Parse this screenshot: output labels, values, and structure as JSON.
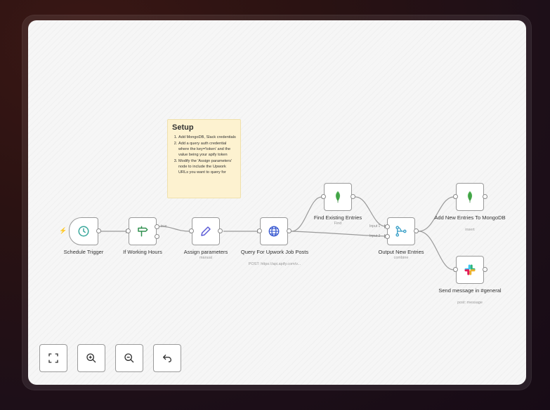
{
  "note": {
    "title": "Setup",
    "steps": [
      "Add MongoDB, Slack credentials",
      "Add a query auth credential where the key='token' and the value being your apify token",
      "Modify the 'Assign parameters' node to include the Upwork URLs you want to query for"
    ]
  },
  "nodes": {
    "schedule": {
      "label": "Schedule Trigger",
      "icon": "clock-icon"
    },
    "hours": {
      "label": "If Working Hours",
      "icon": "signpost-icon",
      "true_label": "true"
    },
    "assign": {
      "label": "Assign parameters",
      "sub": "manual",
      "icon": "pencil-icon"
    },
    "query": {
      "label": "Query For Upwork Job Posts",
      "sub": "POST: https://api.apify.com/v...",
      "icon": "globe-icon"
    },
    "find": {
      "label": "Find Existing Entries",
      "sub": "Find",
      "icon": "mongodb-leaf-icon"
    },
    "output": {
      "label": "Output New Entries",
      "sub": "combine",
      "icon": "merge-icon",
      "input1": "Input 1",
      "input2": "Input 2"
    },
    "addnew": {
      "label": "Add New Entries To MongoDB",
      "sub": "insert",
      "icon": "mongodb-leaf-icon"
    },
    "slack": {
      "label": "Send message in #general",
      "sub": "post: message",
      "icon": "slack-icon"
    }
  },
  "controls": [
    {
      "name": "fit-view",
      "icon": "fit-to-view-icon"
    },
    {
      "name": "zoom-in",
      "icon": "zoom-in-icon"
    },
    {
      "name": "zoom-out",
      "icon": "zoom-out-icon"
    },
    {
      "name": "reset-zoom",
      "icon": "undo-icon"
    }
  ],
  "colors": {
    "accent": "#ff6d5a",
    "clock": "#3aa89c",
    "if": "#2f8f4e",
    "pencil": "#5b5bd6",
    "globe": "#3b5bd1",
    "mongo": "#4caf50",
    "merge": "#3aa0c8"
  }
}
